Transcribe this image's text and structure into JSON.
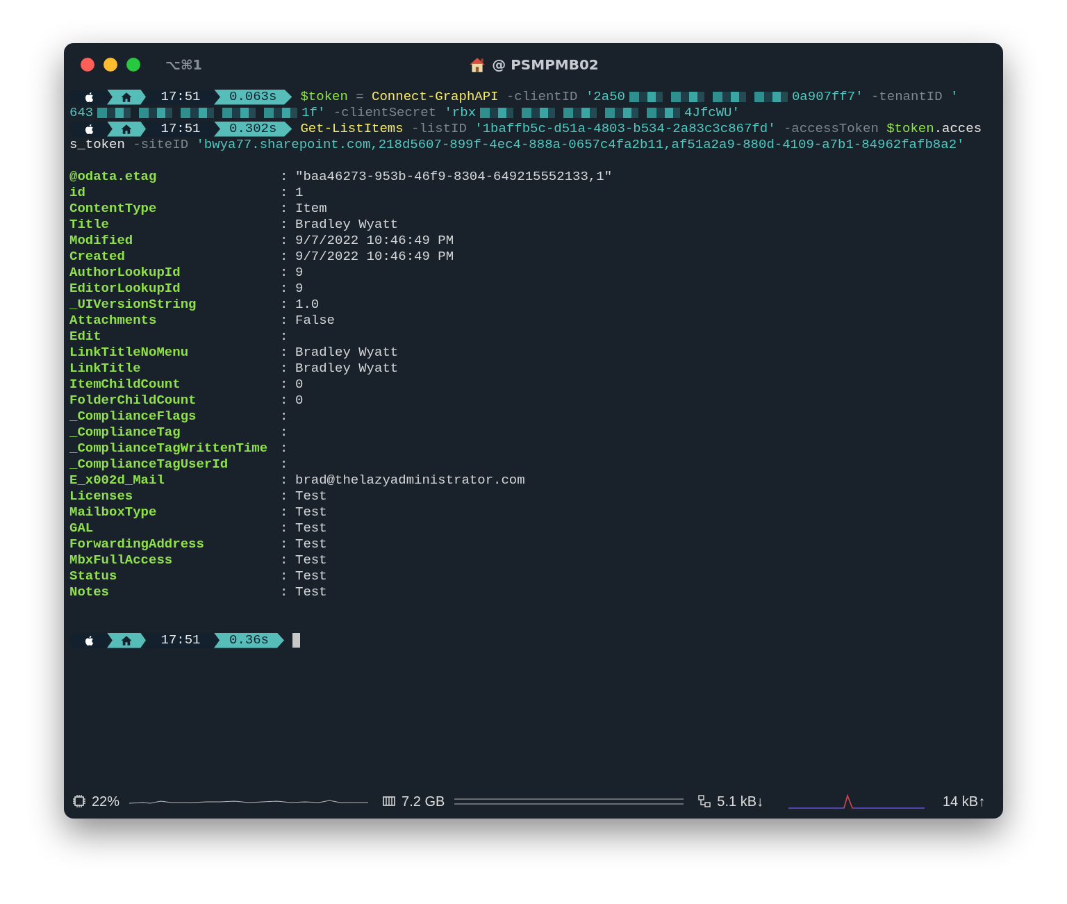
{
  "window": {
    "shortcut": "⌥⌘1",
    "title": "@ PSMPMB02"
  },
  "prompts": [
    {
      "time": "17:51",
      "duration": "0.063s",
      "lines": [
        [
          {
            "kind": "variable",
            "text": "$token"
          },
          {
            "kind": "operator",
            "text": " = "
          },
          {
            "kind": "command",
            "text": "Connect-GraphAPI"
          },
          {
            "kind": "param",
            "text": " -clientID "
          },
          {
            "kind": "string",
            "text": "'2a50"
          },
          {
            "kind": "redacted"
          },
          {
            "kind": "redacted"
          },
          {
            "kind": "redacted"
          },
          {
            "kind": "redacted"
          },
          {
            "kind": "string",
            "text": "0a907ff7'"
          },
          {
            "kind": "param",
            "text": " -tenantID "
          },
          {
            "kind": "string",
            "text": "'"
          }
        ],
        [
          {
            "kind": "string",
            "text": "643"
          },
          {
            "kind": "redacted"
          },
          {
            "kind": "redacted"
          },
          {
            "kind": "redacted"
          },
          {
            "kind": "redacted"
          },
          {
            "kind": "redacted"
          },
          {
            "kind": "string",
            "text": "1f'"
          },
          {
            "kind": "param",
            "text": " -clientSecret "
          },
          {
            "kind": "string",
            "text": "'rbx"
          },
          {
            "kind": "redacted"
          },
          {
            "kind": "redacted"
          },
          {
            "kind": "redacted"
          },
          {
            "kind": "redacted"
          },
          {
            "kind": "redacted"
          },
          {
            "kind": "string",
            "text": "4JfcWU'"
          }
        ]
      ]
    },
    {
      "time": "17:51",
      "duration": "0.302s",
      "lines": [
        [
          {
            "kind": "command",
            "text": "Get-ListItems"
          },
          {
            "kind": "param",
            "text": " -listID "
          },
          {
            "kind": "string",
            "text": "'1baffb5c-d51a-4803-b534-2a83c3c867fd'"
          },
          {
            "kind": "param",
            "text": " -accessToken "
          },
          {
            "kind": "variable",
            "text": "$token"
          },
          {
            "kind": "plain",
            "text": ".acces"
          }
        ],
        [
          {
            "kind": "plain",
            "text": "s_token"
          },
          {
            "kind": "param",
            "text": " -siteID "
          },
          {
            "kind": "string",
            "text": "'bwya77.sharepoint.com,218d5607-899f-4ec4-888a-0657c4fa2b11,af51a2a9-880d-4109-a7b1-84962fafb8a2'"
          }
        ]
      ]
    }
  ],
  "output": [
    {
      "key": "@odata.etag",
      "sep": ":",
      "value": "\"baa46273-953b-46f9-8304-649215552133,1\""
    },
    {
      "key": "id",
      "sep": ":",
      "value": "1"
    },
    {
      "key": "ContentType",
      "sep": ":",
      "value": "Item"
    },
    {
      "key": "Title",
      "sep": ":",
      "value": "Bradley Wyatt"
    },
    {
      "key": "Modified",
      "sep": ":",
      "value": "9/7/2022 10:46:49 PM"
    },
    {
      "key": "Created",
      "sep": ":",
      "value": "9/7/2022 10:46:49 PM"
    },
    {
      "key": "AuthorLookupId",
      "sep": ":",
      "value": "9"
    },
    {
      "key": "EditorLookupId",
      "sep": ":",
      "value": "9"
    },
    {
      "key": "_UIVersionString",
      "sep": ":",
      "value": "1.0"
    },
    {
      "key": "Attachments",
      "sep": ":",
      "value": "False"
    },
    {
      "key": "Edit",
      "sep": ":"
    },
    {
      "key": "LinkTitleNoMenu",
      "sep": ":",
      "value": "Bradley Wyatt"
    },
    {
      "key": "LinkTitle",
      "sep": ":",
      "value": "Bradley Wyatt"
    },
    {
      "key": "ItemChildCount",
      "sep": ":",
      "value": "0"
    },
    {
      "key": "FolderChildCount",
      "sep": ":",
      "value": "0"
    },
    {
      "key": "_ComplianceFlags",
      "sep": ":"
    },
    {
      "key": "_ComplianceTag",
      "sep": ":"
    },
    {
      "key": "_ComplianceTagWrittenTime",
      "sep": ":"
    },
    {
      "key": "_ComplianceTagUserId",
      "sep": ":"
    },
    {
      "key": "E_x002d_Mail",
      "sep": ":",
      "value": "brad@thelazyadministrator.com"
    },
    {
      "key": "Licenses",
      "sep": ":",
      "value": "Test"
    },
    {
      "key": "MailboxType",
      "sep": ":",
      "value": "Test"
    },
    {
      "key": "GAL",
      "sep": ":",
      "value": "Test"
    },
    {
      "key": "ForwardingAddress",
      "sep": ":",
      "value": "Test"
    },
    {
      "key": "MbxFullAccess",
      "sep": ":",
      "value": "Test"
    },
    {
      "key": "Status",
      "sep": ":",
      "value": "Test"
    },
    {
      "key": "Notes",
      "sep": ":",
      "value": "Test"
    }
  ],
  "current_prompt": {
    "time": "17:51",
    "duration": "0.36s"
  },
  "status_bar": {
    "cpu": "22%",
    "memory": "7.2 GB",
    "download": "5.1 kB↓",
    "upload": "14 kB↑"
  }
}
